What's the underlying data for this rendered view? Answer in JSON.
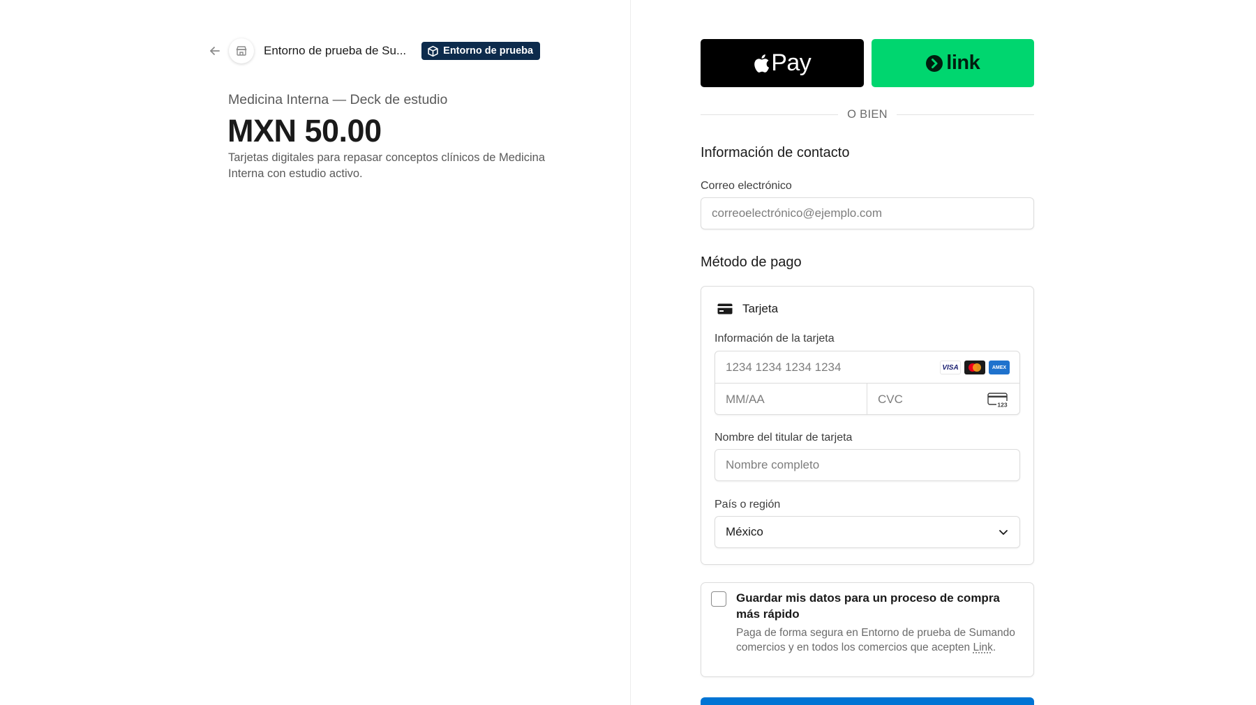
{
  "left": {
    "merchant_name": "Entorno de prueba de Su...",
    "sandbox_badge": "Entorno de prueba",
    "product_name": "Medicina Interna — Deck de estudio",
    "price": "MXN 50.00",
    "description": "Tarjetas digitales para repasar conceptos clínicos de Medicina Interna con estudio activo."
  },
  "wallets": {
    "apple_pay_label": "Pay",
    "link_label": "link"
  },
  "divider_text": "O BIEN",
  "contact": {
    "title": "Información de contacto",
    "email_label": "Correo electrónico",
    "email_placeholder": "correoelectrónico@ejemplo.com"
  },
  "payment": {
    "title": "Método de pago",
    "method_label": "Tarjeta",
    "card_info_label": "Información de la tarjeta",
    "card_number_placeholder": "1234 1234 1234 1234",
    "expiry_placeholder": "MM/AA",
    "cvc_placeholder": "CVC",
    "cvc_icon_text": "123",
    "brands": {
      "visa": "VISA",
      "amex": "AMEX"
    },
    "holder_label": "Nombre del titular de tarjeta",
    "holder_placeholder": "Nombre completo",
    "country_label": "País o región",
    "country_value": "México"
  },
  "save": {
    "title": "Guardar mis datos para un proceso de compra más rápido",
    "desc_before": "Paga de forma segura en Entorno de prueba de Sumando comercios y en todos los comercios que acepten ",
    "desc_link": "Link",
    "desc_after": "."
  },
  "colors": {
    "apple_pay_bg": "#000000",
    "link_bg": "#00d66f",
    "badge_bg": "#0d2b4c",
    "pay_button_bg": "#0074d4"
  }
}
